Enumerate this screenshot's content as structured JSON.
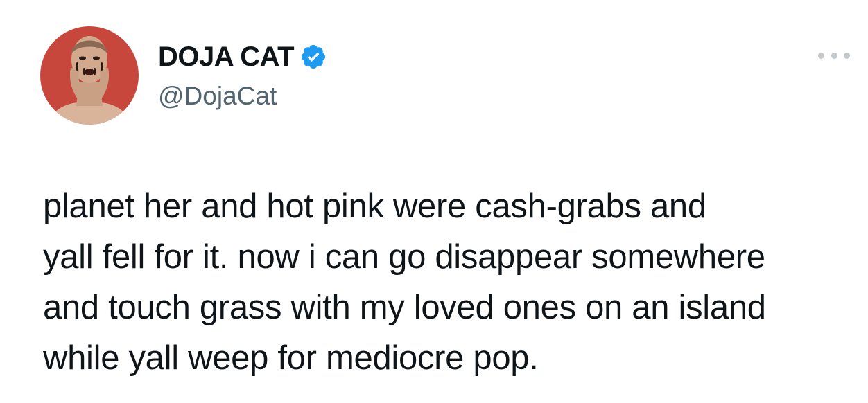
{
  "author": {
    "display_name": "DOJA CAT",
    "handle": "@DojaCat",
    "verified_icon": "verified-badge-icon",
    "avatar_icon": "profile-avatar"
  },
  "colors": {
    "verified_blue": "#1d9bf0",
    "handle_gray": "#536471",
    "text": "#0f1419",
    "avatar_bg": "#c8473c"
  },
  "menu": {
    "icon": "more-options-icon"
  },
  "tweet": {
    "text": "planet her and hot pink were cash-grabs and\nyall fell for it. now i can go disappear somewhere\nand touch grass with my loved ones on an island\nwhile yall weep for mediocre pop."
  }
}
